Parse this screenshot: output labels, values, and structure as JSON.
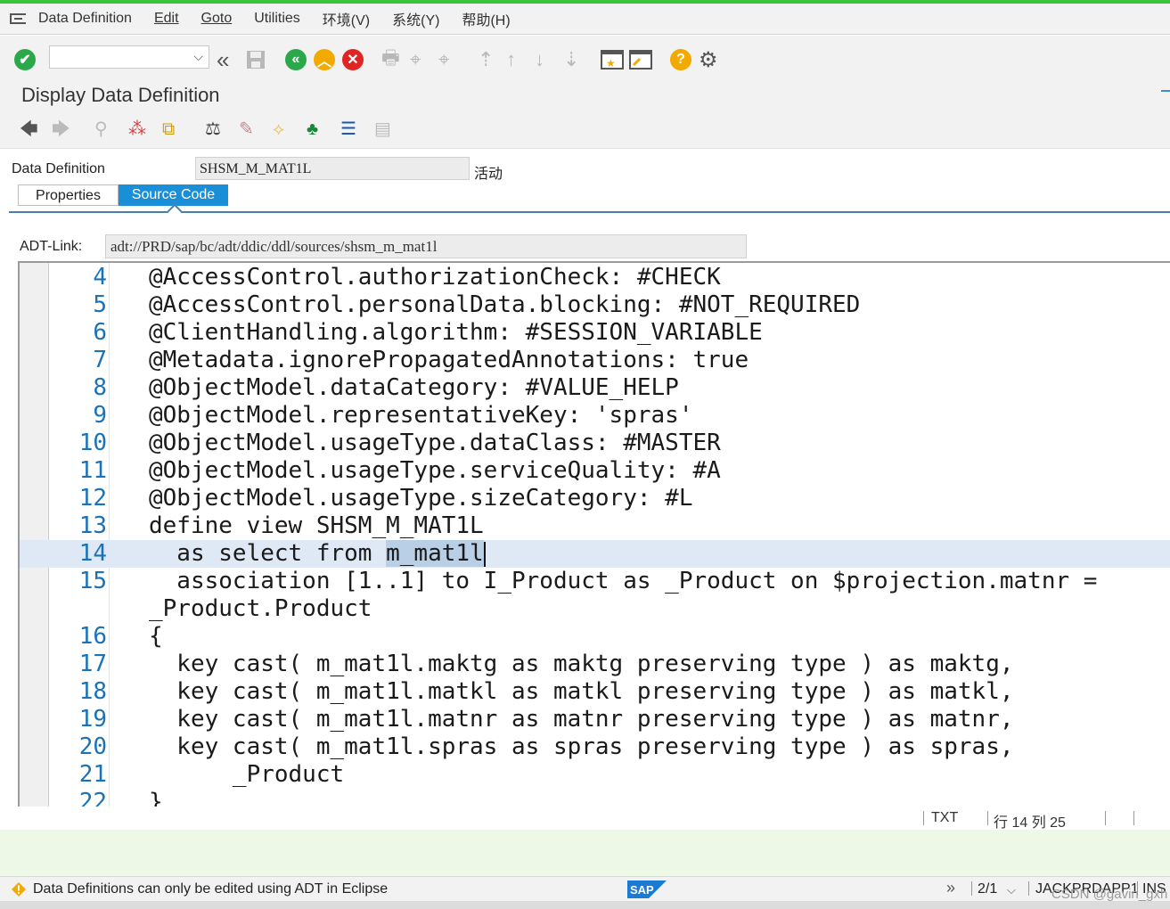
{
  "menu": {
    "items": [
      "Data Definition",
      "Edit",
      "Goto",
      "Utilities",
      "环境(V)",
      "系统(Y)",
      "帮助(H)"
    ]
  },
  "toolbar": {
    "command_value": "",
    "icons": [
      "enter-check-icon",
      "back-icon",
      "save-icon",
      "green-back-icon",
      "exit-up-icon",
      "cancel-icon",
      "print-icon",
      "find-icon",
      "find-next-icon",
      "first-page-icon",
      "previous-page-icon",
      "next-page-icon",
      "last-page-icon",
      "new-session-icon",
      "shortcut-icon",
      "help-icon",
      "settings-icon"
    ]
  },
  "page": {
    "title": "Display Data Definition"
  },
  "form": {
    "label": "Data Definition",
    "value": "SHSM_M_MAT1L",
    "status": "活动"
  },
  "tabs": {
    "properties": "Properties",
    "source_code": "Source Code"
  },
  "adt": {
    "label": "ADT-Link:",
    "value": "adt://PRD/sap/bc/adt/ddic/ddl/sources/shsm_m_mat1l"
  },
  "editor": {
    "lines": [
      {
        "n": "4",
        "t": "@AccessControl.authorizationCheck: #CHECK"
      },
      {
        "n": "5",
        "t": "@AccessControl.personalData.blocking: #NOT_REQUIRED"
      },
      {
        "n": "6",
        "t": "@ClientHandling.algorithm: #SESSION_VARIABLE"
      },
      {
        "n": "7",
        "t": "@Metadata.ignorePropagatedAnnotations: true"
      },
      {
        "n": "8",
        "t": "@ObjectModel.dataCategory: #VALUE_HELP"
      },
      {
        "n": "9",
        "t": "@ObjectModel.representativeKey: 'spras'"
      },
      {
        "n": "10",
        "t": "@ObjectModel.usageType.dataClass: #MASTER"
      },
      {
        "n": "11",
        "t": "@ObjectModel.usageType.serviceQuality: #A"
      },
      {
        "n": "12",
        "t": "@ObjectModel.usageType.sizeCategory: #L"
      },
      {
        "n": "13",
        "t": "define view SHSM_M_MAT1L"
      },
      {
        "n": "14",
        "t": "  as select from ",
        "sel": "m_mat1l"
      },
      {
        "n": "15",
        "t": "  association [1..1] to I_Product as _Product on $projection.matnr ="
      },
      {
        "n": "",
        "t": "_Product.Product"
      },
      {
        "n": "16",
        "t": "{"
      },
      {
        "n": "17",
        "t": "  key cast( m_mat1l.maktg as maktg preserving type ) as maktg,"
      },
      {
        "n": "18",
        "t": "  key cast( m_mat1l.matkl as matkl preserving type ) as matkl,"
      },
      {
        "n": "19",
        "t": "  key cast( m_mat1l.matnr as matnr preserving type ) as matnr,"
      },
      {
        "n": "20",
        "t": "  key cast( m_mat1l.spras as spras preserving type ) as spras,"
      },
      {
        "n": "21",
        "t": "      _Product"
      },
      {
        "n": "22",
        "t": "}"
      }
    ],
    "status": {
      "mode": "TXT",
      "position": "行 14 列 25"
    }
  },
  "statusbar": {
    "message": "Data Definitions can only be edited using ADT in Eclipse",
    "session": "2/1",
    "server": "JACKPRDAPP1",
    "insert_mode": "INS"
  },
  "watermark": "CSDN @gavin_gxh",
  "colors": {
    "accent_green": "#39c43a",
    "tab_active": "#1a8fd8",
    "line_number": "#1a73b8",
    "selection": "#b9cfe6",
    "current_line": "#dfe8f5"
  }
}
